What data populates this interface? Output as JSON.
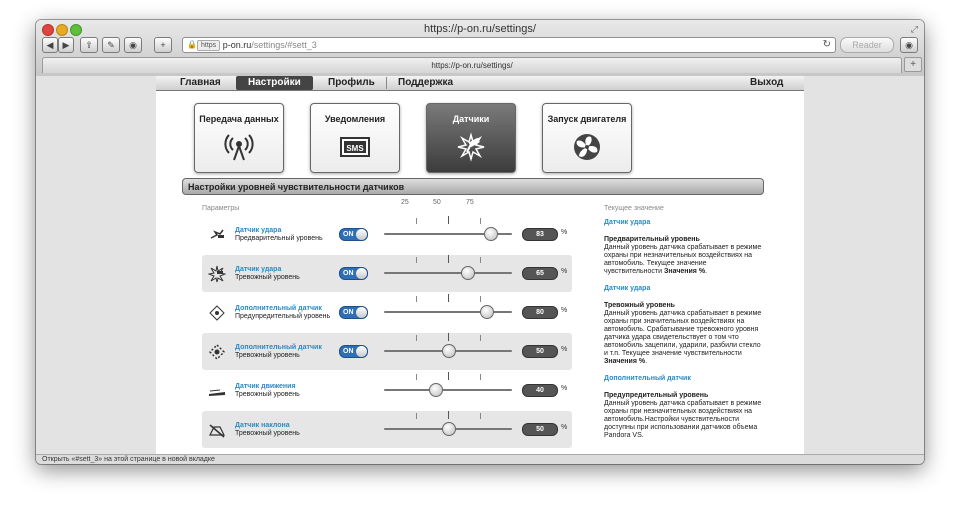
{
  "browser": {
    "window_title": "https://p-on.ru/settings/",
    "url_badge": "https",
    "url_host": "p-on.ru",
    "url_path": "/settings/#sett_3",
    "reader_label": "Reader",
    "tab_title": "https://p-on.ru/settings/",
    "status_text": "Открыть «#sett_3» на этой странице в новой вкладке"
  },
  "menu": {
    "home": "Главная",
    "settings": "Настройки",
    "profile": "Профиль",
    "support": "Поддержка",
    "logout": "Выход"
  },
  "tiles": [
    {
      "label": "Передача данных",
      "icon": "antenna-icon"
    },
    {
      "label": "Уведомления",
      "icon": "sms-icon"
    },
    {
      "label": "Датчики",
      "icon": "shock-sensor-icon"
    },
    {
      "label": "Запуск двигателя",
      "icon": "fan-icon"
    }
  ],
  "section_title": "Настройки уровней чувствительности датчиков",
  "columns": {
    "params": "Параметры",
    "current": "Текущее значение"
  },
  "scale": {
    "t25": "25",
    "t50": "50",
    "t75": "75"
  },
  "toggle_label": "ON",
  "unit": "%",
  "sensors": [
    {
      "title": "Датчик удара",
      "subtitle": "Предварительный уровень",
      "toggle": true,
      "value": 83,
      "value_text": "83",
      "icon": "shock-light-icon"
    },
    {
      "title": "Датчик удара",
      "subtitle": "Тревожный уровень",
      "toggle": true,
      "value": 65,
      "value_text": "65",
      "icon": "shock-strong-icon"
    },
    {
      "title": "Дополнительный датчик",
      "subtitle": "Предупредительный уровень",
      "toggle": true,
      "value": 80,
      "value_text": "80",
      "icon": "extra-sensor-icon"
    },
    {
      "title": "Дополнительный датчик",
      "subtitle": "Тревожный уровень",
      "toggle": true,
      "value": 50,
      "value_text": "50",
      "icon": "extra-sensor-alarm-icon"
    },
    {
      "title": "Датчик движения",
      "subtitle": "Тревожный уровень",
      "toggle": false,
      "value": 40,
      "value_text": "40",
      "icon": "motion-icon"
    },
    {
      "title": "Датчик наклона",
      "subtitle": "Тревожный уровень",
      "toggle": false,
      "value": 50,
      "value_text": "50",
      "icon": "tilt-icon"
    }
  ],
  "info": {
    "b1_title": "Датчик удара",
    "b1_heading": "Предварительный уровень",
    "b1_text": "Данный уровень датчика срабатывает в режиме охраны при незначительных воздействиях на автомобиль. Текущее значение чувствительности",
    "b1_bold": "Значения %",
    "b2_title": "Датчик удара",
    "b2_heading": "Тревожный уровень",
    "b2_text": "Данный уровень датчика срабатывает в режиме охраны при значительных воздействиях на автомобиль. Срабатывание тревожного уровня датчика удара свидетельствует о том что автомобиль зацепили, ударили, разбили стекло и т.п. Текущее значение чувствительности",
    "b2_bold": "Значения %",
    "b3_title": "Дополнительный датчик",
    "b3_heading": "Предупредительный уровень",
    "b3_text": "Данный уровень датчика срабатывает в режиме охраны при незначительных воздействиях на автомобиль.Настройки чувствительности доступны при использовании датчиков объема Pandora VS."
  }
}
